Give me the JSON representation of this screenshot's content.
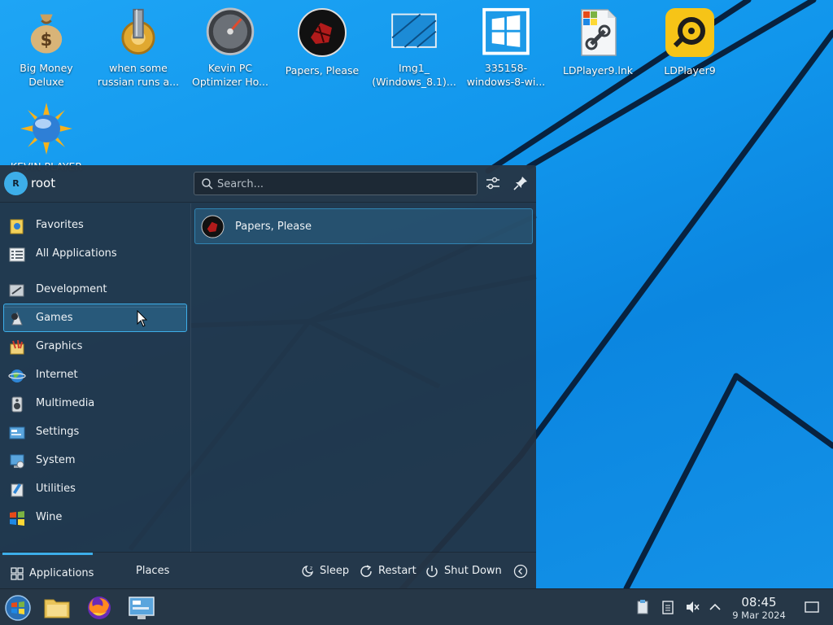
{
  "desktop": {
    "icons": [
      {
        "label": "Big Money Deluxe",
        "icon": "money-bag-icon"
      },
      {
        "label": "when some russian runs a...",
        "icon": "cog-drill-icon"
      },
      {
        "label": "Kevin PC Optimizer Ho...",
        "icon": "speedometer-icon"
      },
      {
        "label": "Papers, Please",
        "icon": "papers-please-icon"
      },
      {
        "label": "Img1_ (Windows_8.1)...",
        "icon": "image-file-icon"
      },
      {
        "label": "335158- windows-8-wi...",
        "icon": "windows-logo-icon"
      },
      {
        "label": "LDPlayer9.lnk",
        "icon": "shortcut-file-icon"
      },
      {
        "label": "LDPlayer9",
        "icon": "ldplayer-icon"
      },
      {
        "label": "KEVIN PLAYER",
        "icon": "sun-globe-icon"
      }
    ]
  },
  "launcher": {
    "user": {
      "initial": "R",
      "name": "root"
    },
    "search": {
      "placeholder": "Search...",
      "value": ""
    },
    "categories": [
      {
        "label": "Favorites",
        "icon": "favorites-icon",
        "selected": false
      },
      {
        "label": "All Applications",
        "icon": "all-applications-icon",
        "selected": false
      },
      {
        "label": "Development",
        "icon": "development-icon",
        "selected": false
      },
      {
        "label": "Games",
        "icon": "games-icon",
        "selected": true
      },
      {
        "label": "Graphics",
        "icon": "graphics-icon",
        "selected": false
      },
      {
        "label": "Internet",
        "icon": "internet-icon",
        "selected": false
      },
      {
        "label": "Multimedia",
        "icon": "multimedia-icon",
        "selected": false
      },
      {
        "label": "Settings",
        "icon": "settings-icon",
        "selected": false
      },
      {
        "label": "System",
        "icon": "system-icon",
        "selected": false
      },
      {
        "label": "Utilities",
        "icon": "utilities-icon",
        "selected": false
      },
      {
        "label": "Wine",
        "icon": "wine-icon",
        "selected": false
      }
    ],
    "results": [
      {
        "label": "Papers, Please",
        "icon": "papers-please-icon"
      }
    ],
    "footer": {
      "tabs": [
        {
          "label": "Applications",
          "active": true
        },
        {
          "label": "Places",
          "active": false
        }
      ],
      "power": [
        {
          "label": "Sleep",
          "icon": "sleep-icon"
        },
        {
          "label": "Restart",
          "icon": "restart-icon"
        },
        {
          "label": "Shut Down",
          "icon": "shutdown-icon"
        }
      ]
    }
  },
  "taskbar": {
    "apps": [
      {
        "name": "start-menu",
        "icon": "windows-start-orb-icon",
        "active": true
      },
      {
        "name": "file-manager",
        "icon": "folder-icon",
        "active": false
      },
      {
        "name": "firefox",
        "icon": "firefox-icon",
        "active": false
      },
      {
        "name": "system-settings",
        "icon": "control-panel-icon",
        "active": false
      }
    ],
    "clock": {
      "time": "08:45",
      "date": "9 Mar 2024"
    }
  },
  "colors": {
    "accent": "#3daee9",
    "panel": "#263747",
    "wallpaper": "#1196ec"
  }
}
